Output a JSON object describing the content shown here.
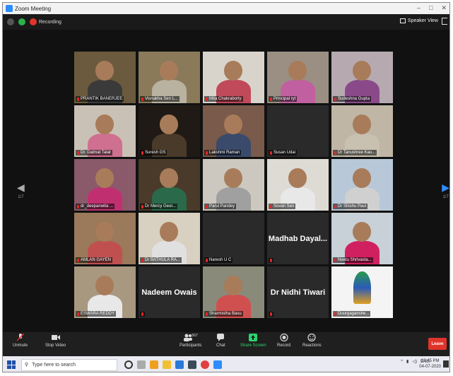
{
  "window": {
    "title": "Zoom Meeting"
  },
  "topbar": {
    "recording_label": "Recording",
    "speaker_view_label": "Speaker View"
  },
  "pagination": {
    "left": "1/7",
    "right": "1/7"
  },
  "participants": [
    {
      "name": "PRANTIK BANERJEE",
      "bg": "#6b5a3e",
      "shirt": "#3a3a3a",
      "active": true
    },
    {
      "name": "Visnakha Sen L...",
      "bg": "#8a7a5a",
      "shirt": "#b9b2a0",
      "active": false
    },
    {
      "name": "Mita Chakraborty",
      "bg": "#d8d4cc",
      "shirt": "#c04a5a",
      "active": false
    },
    {
      "name": "Principal ryt",
      "bg": "#9a8f82",
      "shirt": "#c060a0",
      "active": false
    },
    {
      "name": "Sudeshna Gupta",
      "bg": "#b7a9b0",
      "shirt": "#8a4a8a",
      "active": false
    },
    {
      "name": "Dr. Dalmat Talat",
      "bg": "#c9c1b5",
      "shirt": "#d07090",
      "active": false
    },
    {
      "name": "Suresh GS",
      "bg": "#1f1a15",
      "shirt": "#4a3a2a",
      "active": false
    },
    {
      "name": "Lakshmi Raman",
      "bg": "#7a5a4a",
      "shirt": "#3a4a6a",
      "active": false
    },
    {
      "name": "Susan Udai",
      "bg": "#2a2a2a",
      "shirt": "#2a2a2a",
      "active": false,
      "video_off": true
    },
    {
      "name": "Dr Tanushree Kau...",
      "bg": "#bfb6a6",
      "shirt": "#c8c0b0",
      "active": false
    },
    {
      "name": "dr_deepanwita ...",
      "bg": "#8a5a6a",
      "shirt": "#c03070",
      "active": false
    },
    {
      "name": "Dr Mercy Geor...",
      "bg": "#4a3a2a",
      "shirt": "#2a6a4a",
      "active": false
    },
    {
      "name": "Parul Pandey",
      "bg": "#ccc8c0",
      "shirt": "#a0a0a0",
      "active": false
    },
    {
      "name": "Sovan Sen",
      "bg": "#dedad4",
      "shirt": "#e8e8e8",
      "active": false
    },
    {
      "name": "Dr Shishu Paul",
      "bg": "#b8c8d8",
      "shirt": "#d0d0d0",
      "active": false
    },
    {
      "name": "AMLAN GAYEN",
      "bg": "#9a7a5a",
      "shirt": "#c05050",
      "active": false
    },
    {
      "name": "Dr BATHULA RA...",
      "bg": "#d8d0c0",
      "shirt": "#e0e0e0",
      "active": false
    },
    {
      "name": "Naresh U C",
      "bg": "#2a2a2a",
      "shirt": "#2a2a2a",
      "active": false,
      "video_off": true
    },
    {
      "name": "",
      "display_name": "Madhab Dayal...",
      "bg": "#2a2a2a",
      "active": false,
      "text_tile": true
    },
    {
      "name": "Neetu Shrivasta...",
      "bg": "#c8d0d8",
      "shirt": "#d02060",
      "active": false
    },
    {
      "name": "ESWARA REDDY",
      "bg": "#a89880",
      "shirt": "#e8e8e8",
      "active": false
    },
    {
      "name": "",
      "display_name": "Nadeem Owais",
      "bg": "#2a2a2a",
      "active": false,
      "text_tile": true
    },
    {
      "name": "Sharmistha Basu",
      "bg": "#8a8a7a",
      "shirt": "#d05050",
      "active": false
    },
    {
      "name": "",
      "display_name": "Dr Nidhi Tiwari",
      "bg": "#2a2a2a",
      "active": false,
      "text_tile": true
    },
    {
      "name": "Duurgaganshe...",
      "bg": "#f4f4f4",
      "shirt": "#f4f4f4",
      "active": false,
      "logo": true
    }
  ],
  "toolbar": {
    "unmute": "Unmute",
    "stop_video": "Stop Video",
    "participants": "Participants",
    "participants_count": "567",
    "chat": "Chat",
    "share_screen": "Share Screen",
    "record": "Record",
    "reactions": "Reactions",
    "leave": "Leave"
  },
  "taskbar": {
    "search_placeholder": "Type here to search",
    "lang": "ENG",
    "time": "12:45 PM",
    "date": "04-07-2020"
  }
}
